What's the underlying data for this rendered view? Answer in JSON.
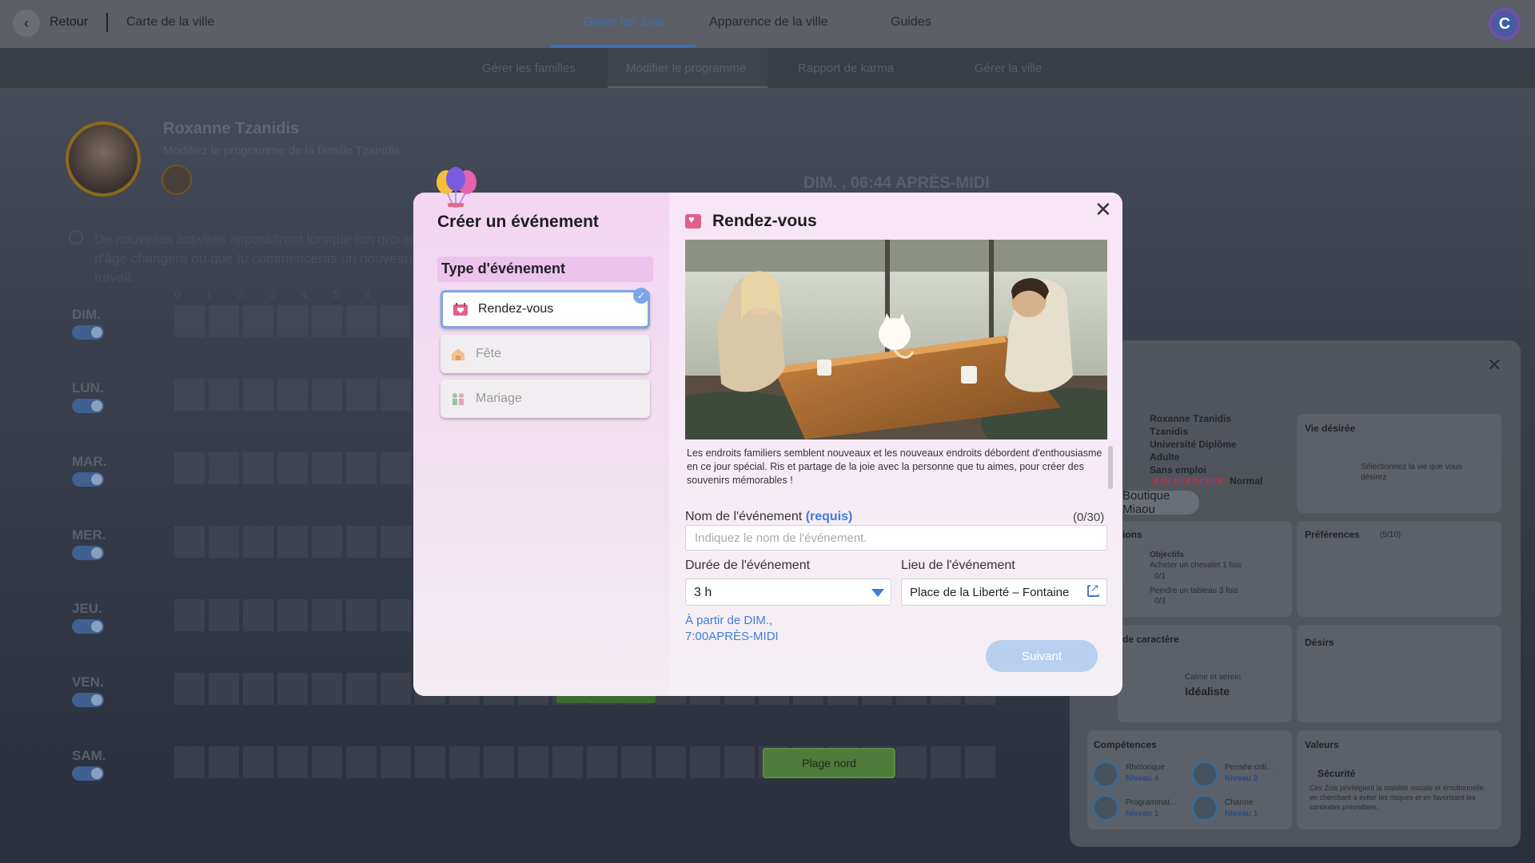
{
  "topbar": {
    "back_label": "Retour",
    "breadcrumb": "Carte de la ville",
    "tabs": [
      "Gérer les Zois",
      "Apparence de la ville",
      "Guides"
    ],
    "avatar_letter": "C"
  },
  "subtabs": [
    "Gérer les familles",
    "Modifier le programme",
    "Rapport de karma",
    "Gérer la ville"
  ],
  "family": {
    "name": "Roxanne Tzanidis",
    "subtitle": "Modifiez le programme de la famille Tzanidis.",
    "note": "De nouvelles activités apparaîtront lorsque ton groupe d'âge changera ou que tu commenceras un nouveau travail."
  },
  "datetime": "DIM. , 06:44 APRÈS-MIDI",
  "hours": "0 1 2 3 4 5 6",
  "days": [
    "DIM.",
    "LUN.",
    "MAR.",
    "MER.",
    "JEU.",
    "VEN.",
    "SAM."
  ],
  "background_event": "Plage nord",
  "zoi_panel": {
    "info": [
      "Roxanne Tzanidis",
      "Tzanidis",
      "Université Diplôme",
      "Adulte",
      "Sans emploi"
    ],
    "mood": "Normal",
    "shop": "Boutique Miaou",
    "sections": {
      "dream_life": "Vie désirée",
      "dream_life_hint": "Sélectionnez la vie que vous désirez",
      "ambitions": "ions",
      "objectives": "Objectifs",
      "objective1": "Acheter un chevalet 1 fois",
      "objective1_progress": "0/1",
      "objective2": "Peindre un tableau 3 fois",
      "objective2_progress": "0/3",
      "preferences": "Préférences",
      "preferences_count": "(5/10)",
      "traits": "de caractère",
      "trait_sub": "Calme et serein",
      "trait_name": "Idéaliste",
      "desires": "Désirs",
      "skills": "Compétences",
      "skill1": "Rhétorique",
      "skill1_level": "Niveau 4",
      "skill2": "Pensée criti...",
      "skill2_level": "Niveau 2",
      "skill3": "Programmat...",
      "skill3_level": "Niveau 1",
      "skill4": "Charme",
      "skill4_level": "Niveau 1",
      "values": "Valeurs",
      "value_name": "Sécurité",
      "value_desc": "Ces Zois privilégient la stabilité sociale et émotionnelle, en cherchant à éviter les risques et en favorisant les contextes prévisibles."
    }
  },
  "modal": {
    "title": "Créer un événement",
    "type_header": "Type d'événement",
    "types": [
      {
        "label": "Rendez-vous",
        "icon": "heart-calendar-icon",
        "selected": true
      },
      {
        "label": "Fête",
        "icon": "party-house-icon",
        "selected": false
      },
      {
        "label": "Mariage",
        "icon": "wedding-icon",
        "selected": false
      }
    ],
    "event_title": "Rendez-vous",
    "description": "Les endroits familiers semblent nouveaux et les nouveaux endroits débordent d'enthousiasme en ce jour spécial. Ris et partage de la joie avec la personne que tu aimes, pour créer des souvenirs mémorables !",
    "name_label": "Nom de l'événement",
    "required": "(requis)",
    "counter": "(0/30)",
    "name_placeholder": "Indiquez le nom de l'événement.",
    "duration_label": "Durée de l'événement",
    "duration_value": "3 h",
    "location_label": "Lieu de l'événement",
    "location_value": "Place de la Liberté – Fontaine",
    "start_line1": "À partir de DIM.,",
    "start_line2": "7:00APRÈS-MIDI",
    "next_label": "Suivant"
  },
  "colors": {
    "accent": "#3d7dd8",
    "selected_border": "#7da6e6",
    "modal_bg": "#f5d9f4"
  }
}
